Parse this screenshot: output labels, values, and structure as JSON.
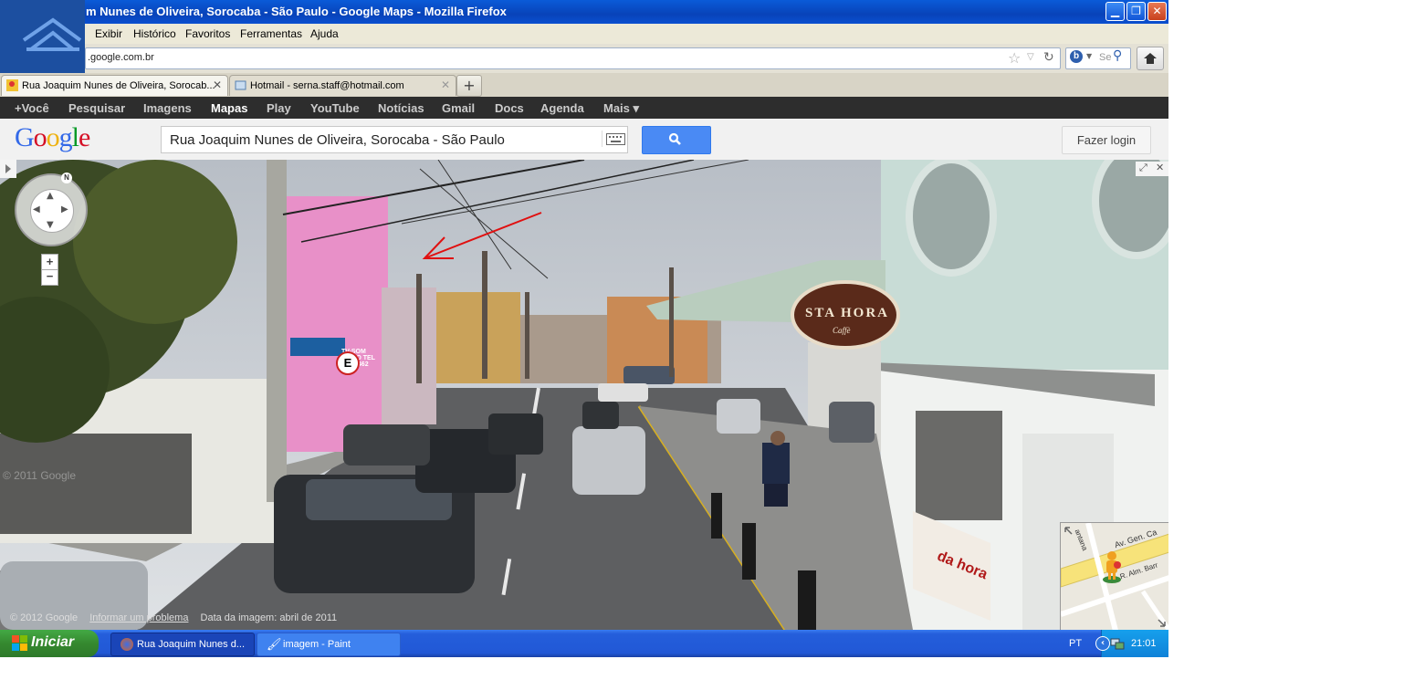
{
  "window": {
    "title": "m Nunes de Oliveira, Sorocaba - São Paulo - Google Maps - Mozilla Firefox",
    "minimize": "▁",
    "restore": "❐",
    "close": "✕"
  },
  "menu": {
    "items": [
      "Exibir",
      "Histórico",
      "Favoritos",
      "Ferramentas",
      "Ajuda"
    ]
  },
  "navbar": {
    "url": ".google.com.br",
    "search_placeholder": "Se",
    "home_icon": "home-icon"
  },
  "tabs": [
    {
      "label": "Rua Joaquim Nunes de Oliveira, Sorocab...",
      "close": "✕",
      "active": true
    },
    {
      "label": "Hotmail - serna.staff@hotmail.com",
      "close": "✕",
      "active": false
    }
  ],
  "new_tab": "+",
  "google_bar": {
    "items": [
      "+Você",
      "Pesquisar",
      "Imagens",
      "Mapas",
      "Play",
      "YouTube",
      "Notícias",
      "Gmail",
      "Docs",
      "Agenda",
      "Mais ▾"
    ]
  },
  "header": {
    "logo": "Google",
    "query": "Rua Joaquim Nunes de Oliveira, Sorocaba - São Paulo",
    "login_label": "Fazer login"
  },
  "streetview": {
    "compass_letter": "N",
    "zoom_in": "+",
    "zoom_out": "−",
    "watermark": "© 2011 Google",
    "copyright": "© 2012 Google",
    "report_link": "Informar um problema",
    "image_date": "Data da imagem: abril de 2011",
    "sign_text": "STA HORA",
    "sign_sub": "Caffè",
    "shop_sign": "TV-SOM VIDEO TEL 221-7462",
    "parking_sign": "E",
    "banner_text": "da hora",
    "minimap_labels": [
      "Av. Gen. Ca",
      "R. Alm. Barr",
      "antana"
    ]
  },
  "taskbar": {
    "start_label": "Iniciar",
    "tasks": [
      {
        "label": "Rua Joaquim Nunes d..."
      },
      {
        "label": "imagem - Paint"
      }
    ],
    "lang": "PT",
    "clock": "21:01"
  },
  "colors": {
    "title_blue": "#0843b9",
    "google_bar": "#2d2d2d",
    "search_blue": "#4a8af4",
    "taskbar_blue": "#245edb",
    "start_green": "#35892f",
    "arrow_red": "#e01010"
  }
}
